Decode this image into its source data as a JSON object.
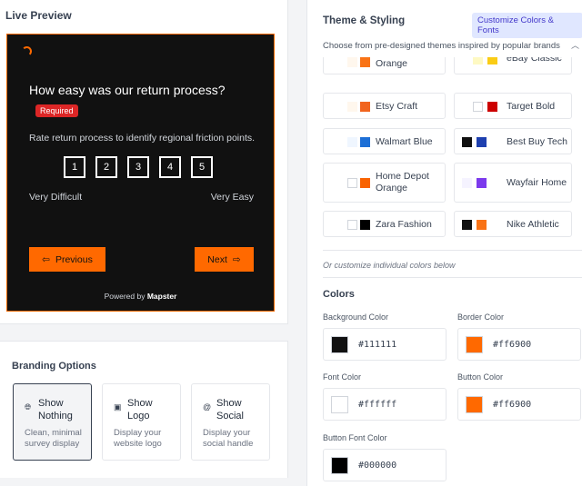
{
  "preview": {
    "title": "Live Preview",
    "question": "How easy was our return process?",
    "required": "Required",
    "subtext": "Rate return process to identify regional friction points.",
    "scale": [
      "1",
      "2",
      "3",
      "4",
      "5"
    ],
    "low_label": "Very Difficult",
    "high_label": "Very Easy",
    "prev_label": "Previous",
    "next_label": "Next",
    "powered_prefix": "Powered by",
    "powered_brand": "Mapster"
  },
  "branding": {
    "title": "Branding Options",
    "options": [
      {
        "title": "Show Nothing",
        "desc": "Clean, minimal survey display",
        "icon": "globe-icon",
        "selected": true
      },
      {
        "title": "Show Logo",
        "desc": "Display your website logo",
        "icon": "image-icon",
        "selected": false
      },
      {
        "title": "Show Social",
        "desc": "Display your social handle",
        "icon": "at-icon",
        "selected": false
      }
    ]
  },
  "theme": {
    "title": "Theme & Styling",
    "customize_badge": "Customize Colors & Fonts",
    "choose_text": "Choose from pre-designed themes inspired by popular brands",
    "themes": [
      {
        "name": "Orange",
        "colors": [
          "#fff7ed",
          "#f97316"
        ]
      },
      {
        "name": "eBay Classic",
        "colors": [
          "#fef9c3",
          "#facc15"
        ]
      },
      {
        "name": "Etsy Craft",
        "colors": [
          "#fff7ed",
          "#f1641e"
        ]
      },
      {
        "name": "Target Bold",
        "colors": [
          "#ffffff",
          "#cc0000"
        ]
      },
      {
        "name": "Walmart Blue",
        "colors": [
          "#eff6ff",
          "#1d6fd6"
        ]
      },
      {
        "name": "Best Buy Tech",
        "colors": [
          "#111111",
          "#1e40af"
        ]
      },
      {
        "name": "Home Depot Orange",
        "colors": [
          "#ffffff",
          "#f96302"
        ]
      },
      {
        "name": "Wayfair Home",
        "colors": [
          "#f5f3ff",
          "#7c3aed"
        ]
      },
      {
        "name": "Zara Fashion",
        "colors": [
          "#ffffff",
          "#000000"
        ]
      },
      {
        "name": "Nike Athletic",
        "colors": [
          "#111111",
          "#f97316"
        ]
      }
    ],
    "or_text": "Or customize individual colors below"
  },
  "colors": {
    "title": "Colors",
    "fields": [
      {
        "label": "Background Color",
        "value": "#111111"
      },
      {
        "label": "Border Color",
        "value": "#ff6900"
      },
      {
        "label": "Font Color",
        "value": "#ffffff"
      },
      {
        "label": "Button Color",
        "value": "#ff6900"
      },
      {
        "label": "Button Font Color",
        "value": "#000000"
      }
    ]
  }
}
